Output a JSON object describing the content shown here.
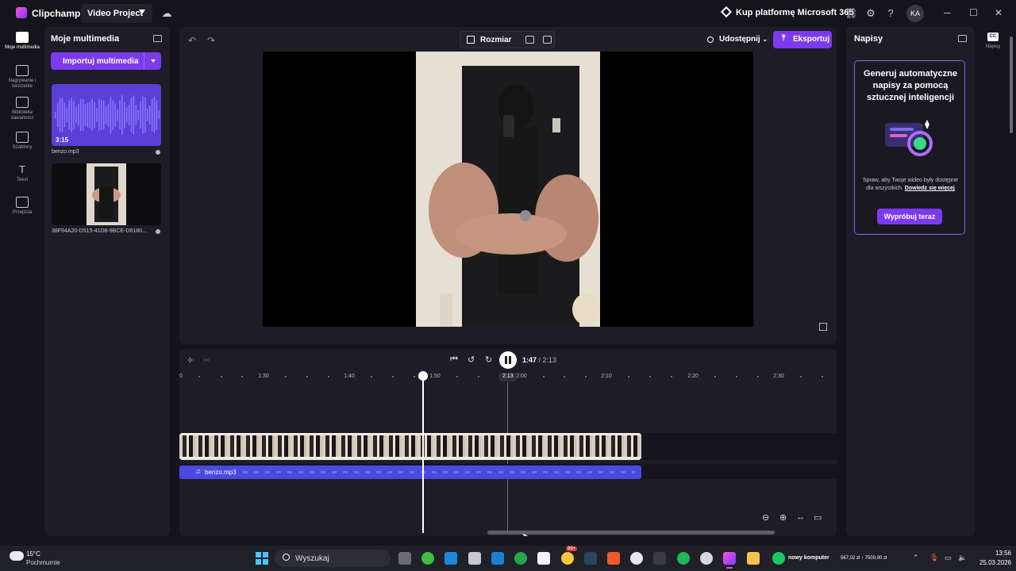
{
  "titlebar": {
    "app_name": "Clipchamp",
    "project_name": "Video Project",
    "promo": "Kup platformę Microsoft 365",
    "avatar_initials": "KA"
  },
  "rail": {
    "items": [
      {
        "label": "Moje multimedia",
        "icon": "folder-icon"
      },
      {
        "label": "Nagrywanie i tworzenie",
        "icon": "camera-icon"
      },
      {
        "label": "Biblioteka zawartości",
        "icon": "library-icon"
      },
      {
        "label": "Szablony",
        "icon": "templates-icon"
      },
      {
        "label": "Tekst",
        "icon": "text-icon"
      },
      {
        "label": "Przejścia",
        "icon": "transitions-icon"
      }
    ]
  },
  "media_panel": {
    "title": "Moje multimedia",
    "import_label": "Importuj multimedia",
    "items": [
      {
        "name": "benzo.mp3",
        "duration": "3:15",
        "type": "audio"
      },
      {
        "name": "38F94A20-D515-41D8-9BCE-D6180...",
        "type": "video"
      }
    ]
  },
  "toolbar": {
    "size_label": "Rozmiar",
    "share_label": "Udostępnij",
    "export_label": "Eksportuj"
  },
  "player": {
    "current_time": "1:47",
    "total_time": "/ 2:13",
    "hover_time": "2:13"
  },
  "ruler": {
    "labels": [
      "0",
      "1:30",
      "1:40",
      "1:50",
      "2:00",
      "2:10",
      "2:20",
      "2:30"
    ]
  },
  "tracks": {
    "audio_clip_name": "benzo.mp3"
  },
  "captions": {
    "title": "Napisy",
    "heading": "Generuj automatyczne napisy za pomocą sztucznej inteligencji",
    "description": "Spraw, aby Twoje wideo były dostępne dla wszystkich.",
    "learn_more": "Dowiedz się więcej",
    "try_button": "Wypróbuj teraz",
    "rail_label": "Napisy",
    "rail_badge": "CC"
  },
  "taskbar": {
    "temperature": "15°C",
    "weather": "Pochmurnie",
    "search_placeholder": "Wyszukaj",
    "app_label": "nowy komputer",
    "ticker": "567,02 zł ↑ 7500,00 zł",
    "badge": "99+",
    "time": "13:56",
    "date": "25.03.2026"
  },
  "colors": {
    "accent": "#7c3aed",
    "audio_clip": "#4a4ae0"
  }
}
